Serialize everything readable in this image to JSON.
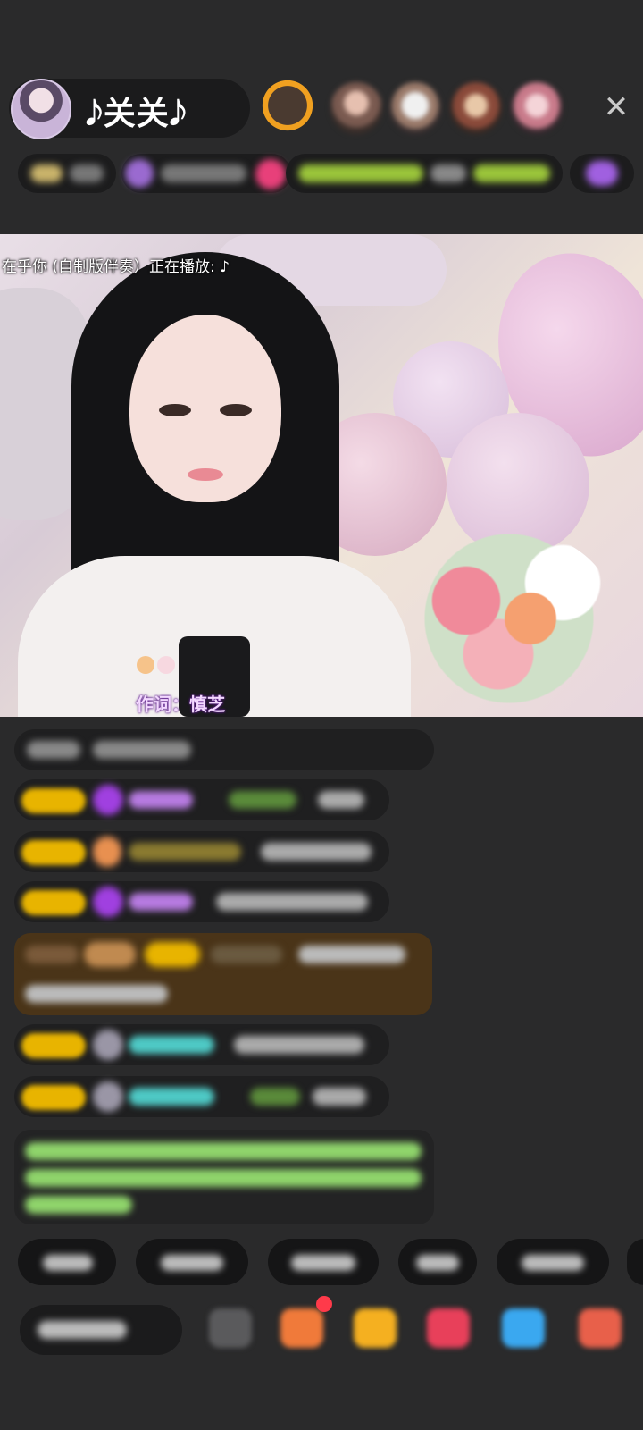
{
  "header": {
    "host_name": "𝅘𝅥𝅮关关𝅘𝅥𝅮",
    "close_glyph": "✕"
  },
  "video": {
    "now_playing_banner": "在乎你 (自制版伴奏）正在播放: ♪",
    "lyric_line": "作词：慎芝"
  },
  "colors": {
    "background": "#2a2a2b",
    "badge_gold": "#e8b400",
    "chat_pill": "#1f1f20",
    "purple_name": "#b67ae0",
    "teal_name": "#4ec9c5",
    "green_notice": "#8fd46b"
  },
  "icons": [
    "close-icon",
    "gem-icon",
    "heart-gift-icon",
    "emoji-icon",
    "gift-box-icon"
  ]
}
